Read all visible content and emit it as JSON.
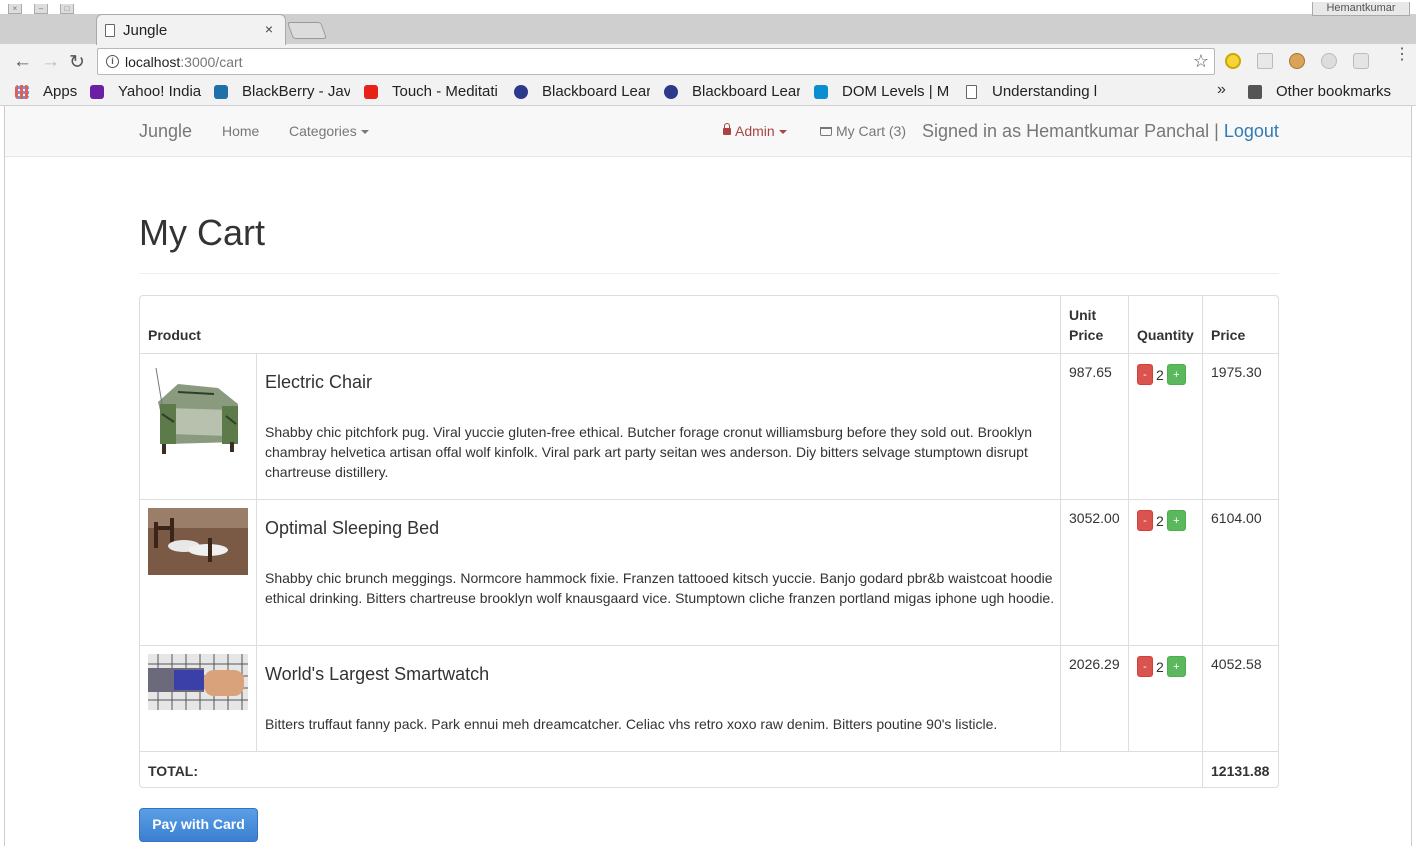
{
  "browser": {
    "profile_name": "Hemantkumar",
    "tab_title": "Jungle",
    "tab_close": "×",
    "url_host": "localhost",
    "url_path": ":3000/cart",
    "bookmarks": [
      {
        "label": "Apps"
      },
      {
        "label": "Yahoo! India"
      },
      {
        "label": "BlackBerry - Jav"
      },
      {
        "label": "Touch - Meditati"
      },
      {
        "label": "Blackboard Lear"
      },
      {
        "label": "Blackboard Lear"
      },
      {
        "label": "DOM Levels | MI"
      },
      {
        "label": "Understanding l"
      }
    ],
    "overflow_chevron": "»",
    "other_bookmarks": "Other bookmarks"
  },
  "navbar": {
    "brand": "Jungle",
    "home": "Home",
    "categories": "Categories",
    "admin": "Admin",
    "my_cart": "My Cart (3)",
    "signed_in": "Signed in as Hemantkumar Panchal |",
    "logout": "Logout"
  },
  "main": {
    "title": "My Cart",
    "headers": {
      "product": "Product",
      "unit_price_1": "Unit",
      "unit_price_2": "Price",
      "quantity": "Quantity",
      "price": "Price"
    },
    "items": [
      {
        "name": "Electric Chair",
        "description": "Shabby chic pitchfork pug. Viral yuccie gluten-free ethical. Butcher forage cronut williamsburg before they sold out. Brooklyn chambray helvetica artisan offal wolf kinfolk. Viral park art party seitan wes anderson. Diy bitters selvage stumptown disrupt chartreuse distillery.",
        "unit_price": "987.65",
        "quantity": "2",
        "price": "1975.30"
      },
      {
        "name": "Optimal Sleeping Bed",
        "description": "Shabby chic brunch meggings. Normcore hammock fixie. Franzen tattooed kitsch yuccie. Banjo godard pbr&b waistcoat hoodie ethical drinking. Bitters chartreuse brooklyn wolf knausgaard vice. Stumptown cliche franzen portland migas iphone ugh hoodie.",
        "unit_price": "3052.00",
        "quantity": "2",
        "price": "6104.00"
      },
      {
        "name": "World's Largest Smartwatch",
        "description": "Bitters truffaut fanny pack. Park ennui meh dreamcatcher. Celiac vhs retro xoxo raw denim. Bitters poutine 90's listicle.",
        "unit_price": "2026.29",
        "quantity": "2",
        "price": "4052.58"
      }
    ],
    "minus_label": "-",
    "plus_label": "+",
    "total_label": "TOTAL:",
    "total_value": "12131.88",
    "pay_button": "Pay with Card"
  }
}
